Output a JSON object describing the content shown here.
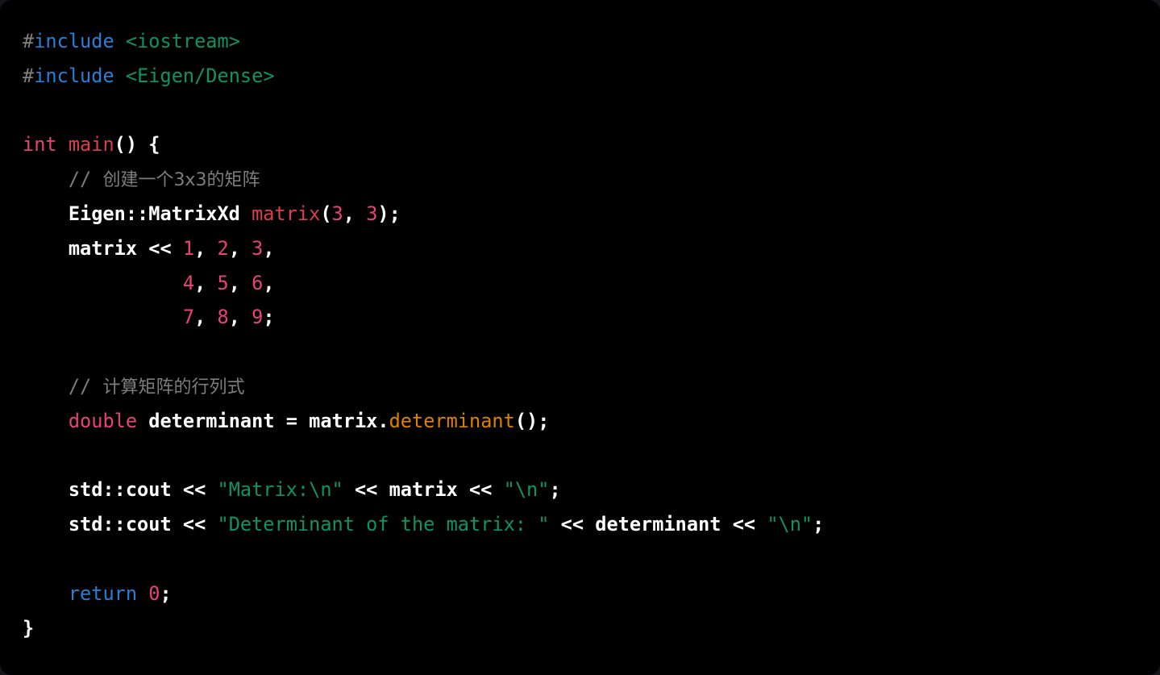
{
  "window": {
    "background_color": "#000000",
    "page_background_color": "#15151c",
    "language": "C++",
    "corner_radius": "14px"
  },
  "theme": {
    "name": "dark-code-snippet",
    "colors": {
      "background": "#000000",
      "plain_text": "#ffffff",
      "preprocessor_hash": "#808080",
      "preprocessor_keyword": "#2a7fd4",
      "header_name": "#0e9268",
      "type_keyword": "#e8417c",
      "control_keyword": "#2a7fd4",
      "function_call": "#da3f4b",
      "method_call": "#df8100",
      "number_literal": "#e8417c",
      "string_literal": "#0e9268",
      "comment": "#7d7d7d"
    }
  },
  "code": {
    "title": "Eigen 3x3 matrix determinant example",
    "lines": [
      {
        "n": 1,
        "indent": 0,
        "text": "#include <iostream>",
        "tokens": [
          {
            "kind": "hash",
            "text": "#"
          },
          {
            "kind": "pre",
            "text": "include"
          },
          {
            "kind": "plain",
            "text": " "
          },
          {
            "kind": "header",
            "text": "<iostream>"
          }
        ]
      },
      {
        "n": 2,
        "indent": 0,
        "text": "#include <Eigen/Dense>",
        "tokens": [
          {
            "kind": "hash",
            "text": "#"
          },
          {
            "kind": "pre",
            "text": "include"
          },
          {
            "kind": "plain",
            "text": " "
          },
          {
            "kind": "header",
            "text": "<Eigen/Dense>"
          }
        ]
      },
      {
        "n": 3,
        "indent": 0,
        "text": "",
        "tokens": []
      },
      {
        "n": 4,
        "indent": 0,
        "text": "int main() {",
        "tokens": [
          {
            "kind": "type",
            "text": "int"
          },
          {
            "kind": "plain",
            "text": " "
          },
          {
            "kind": "fn",
            "text": "main"
          },
          {
            "kind": "punct",
            "text": "() {"
          }
        ]
      },
      {
        "n": 5,
        "indent": 4,
        "text": "    // 创建一个3x3的矩阵",
        "tokens": [
          {
            "kind": "comment",
            "text": "    // "
          },
          {
            "kind": "comment-cjk",
            "text": "创建一个3x3的矩阵"
          }
        ]
      },
      {
        "n": 6,
        "indent": 4,
        "text": "    Eigen::MatrixXd matrix(3, 3);",
        "tokens": [
          {
            "kind": "plain",
            "text": "    Eigen::MatrixXd "
          },
          {
            "kind": "fn",
            "text": "matrix"
          },
          {
            "kind": "punct",
            "text": "("
          },
          {
            "kind": "num",
            "text": "3"
          },
          {
            "kind": "punct",
            "text": ", "
          },
          {
            "kind": "num",
            "text": "3"
          },
          {
            "kind": "punct",
            "text": ");"
          }
        ]
      },
      {
        "n": 7,
        "indent": 4,
        "text": "    matrix << 1, 2, 3,",
        "tokens": [
          {
            "kind": "plain",
            "text": "    matrix << "
          },
          {
            "kind": "num",
            "text": "1"
          },
          {
            "kind": "punct",
            "text": ", "
          },
          {
            "kind": "num",
            "text": "2"
          },
          {
            "kind": "punct",
            "text": ", "
          },
          {
            "kind": "num",
            "text": "3"
          },
          {
            "kind": "punct",
            "text": ","
          }
        ]
      },
      {
        "n": 8,
        "indent": 14,
        "text": "              4, 5, 6,",
        "tokens": [
          {
            "kind": "plain",
            "text": "              "
          },
          {
            "kind": "num",
            "text": "4"
          },
          {
            "kind": "punct",
            "text": ", "
          },
          {
            "kind": "num",
            "text": "5"
          },
          {
            "kind": "punct",
            "text": ", "
          },
          {
            "kind": "num",
            "text": "6"
          },
          {
            "kind": "punct",
            "text": ","
          }
        ]
      },
      {
        "n": 9,
        "indent": 14,
        "text": "              7, 8, 9;",
        "tokens": [
          {
            "kind": "plain",
            "text": "              "
          },
          {
            "kind": "num",
            "text": "7"
          },
          {
            "kind": "punct",
            "text": ", "
          },
          {
            "kind": "num",
            "text": "8"
          },
          {
            "kind": "punct",
            "text": ", "
          },
          {
            "kind": "num",
            "text": "9"
          },
          {
            "kind": "punct",
            "text": ";"
          }
        ]
      },
      {
        "n": 10,
        "indent": 0,
        "text": "",
        "tokens": []
      },
      {
        "n": 11,
        "indent": 4,
        "text": "    // 计算矩阵的行列式",
        "tokens": [
          {
            "kind": "comment",
            "text": "    // "
          },
          {
            "kind": "comment-cjk",
            "text": "计算矩阵的行列式"
          }
        ]
      },
      {
        "n": 12,
        "indent": 4,
        "text": "    double determinant = matrix.determinant();",
        "tokens": [
          {
            "kind": "plain",
            "text": "    "
          },
          {
            "kind": "type",
            "text": "double"
          },
          {
            "kind": "plain",
            "text": " determinant = matrix."
          },
          {
            "kind": "method",
            "text": "determinant"
          },
          {
            "kind": "punct",
            "text": "();"
          }
        ]
      },
      {
        "n": 13,
        "indent": 0,
        "text": "",
        "tokens": []
      },
      {
        "n": 14,
        "indent": 4,
        "text": "    std::cout << \"Matrix:\\n\" << matrix << \"\\n\";",
        "tokens": [
          {
            "kind": "plain",
            "text": "    std::cout << "
          },
          {
            "kind": "str",
            "text": "\"Matrix:\\n\""
          },
          {
            "kind": "plain",
            "text": " << matrix << "
          },
          {
            "kind": "str",
            "text": "\"\\n\""
          },
          {
            "kind": "punct",
            "text": ";"
          }
        ]
      },
      {
        "n": 15,
        "indent": 4,
        "text": "    std::cout << \"Determinant of the matrix: \" << determinant << \"\\n\";",
        "tokens": [
          {
            "kind": "plain",
            "text": "    std::cout << "
          },
          {
            "kind": "str",
            "text": "\"Determinant of the matrix: \""
          },
          {
            "kind": "plain",
            "text": " << determinant << "
          },
          {
            "kind": "str",
            "text": "\"\\n\""
          },
          {
            "kind": "punct",
            "text": ";"
          }
        ]
      },
      {
        "n": 16,
        "indent": 0,
        "text": "",
        "tokens": []
      },
      {
        "n": 17,
        "indent": 4,
        "text": "    return 0;",
        "tokens": [
          {
            "kind": "plain",
            "text": "    "
          },
          {
            "kind": "ctrl",
            "text": "return"
          },
          {
            "kind": "plain",
            "text": " "
          },
          {
            "kind": "num",
            "text": "0"
          },
          {
            "kind": "punct",
            "text": ";"
          }
        ]
      },
      {
        "n": 18,
        "indent": 0,
        "text": "}",
        "tokens": [
          {
            "kind": "punct",
            "text": "}"
          }
        ]
      }
    ]
  }
}
